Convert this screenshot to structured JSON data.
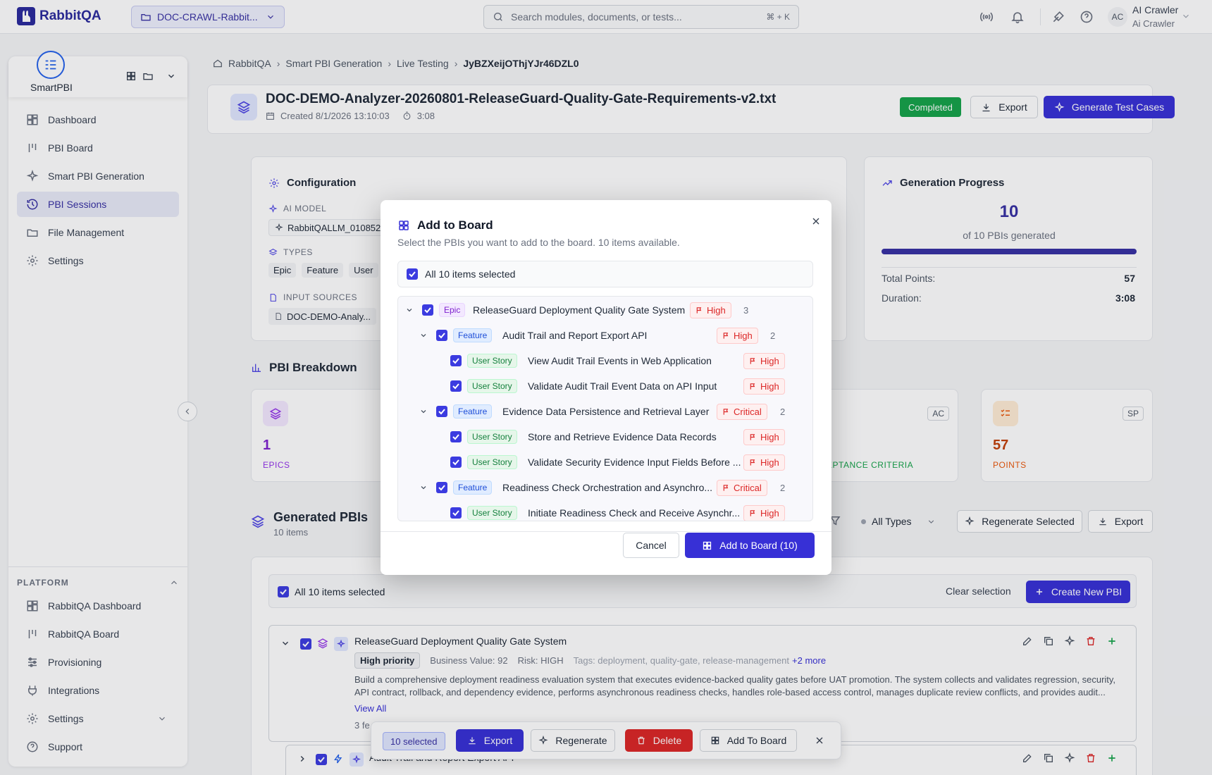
{
  "app": {
    "name": "RabbitQA"
  },
  "topbar": {
    "project": "DOC-CRAWL-Rabbit...",
    "search_placeholder": "Search modules, documents, or tests...",
    "shortcut": "⌘ + K",
    "avatar_initials": "AC",
    "user_name": "AI Crawler",
    "user_role": "Ai Crawler"
  },
  "sidebar": {
    "module_name": "SmartPBI",
    "items": [
      {
        "label": "Dashboard",
        "icon": "dashboard-icon"
      },
      {
        "label": "PBI Board",
        "icon": "board-icon"
      },
      {
        "label": "Smart PBI Generation",
        "icon": "sparkle-icon"
      },
      {
        "label": "PBI Sessions",
        "icon": "history-icon"
      },
      {
        "label": "File Management",
        "icon": "folder-icon"
      },
      {
        "label": "Settings",
        "icon": "gear-icon"
      }
    ],
    "platform_label": "PLATFORM",
    "platform_items": [
      {
        "label": "RabbitQA Dashboard"
      },
      {
        "label": "RabbitQA Board"
      },
      {
        "label": "Provisioning"
      },
      {
        "label": "Integrations"
      },
      {
        "label": "Settings"
      },
      {
        "label": "Support"
      }
    ]
  },
  "breadcrumb": [
    "RabbitQA",
    "Smart PBI Generation",
    "Live Testing",
    "JyBZXeijOThjYJr46DZL0"
  ],
  "header": {
    "title": "DOC-DEMO-Analyzer-20260801-ReleaseGuard-Quality-Gate-Requirements-v2.txt",
    "created": "Created 8/1/2026  13:10:03",
    "duration": "3:08",
    "status": "Completed",
    "export_label": "Export",
    "generate_label": "Generate Test Cases"
  },
  "config": {
    "title": "Configuration",
    "ai_model_label": "AI MODEL",
    "ai_model_value": "RabbitQALLM_010852",
    "types_label": "TYPES",
    "types": [
      "Epic",
      "Feature",
      "User"
    ],
    "sources_label": "INPUT SOURCES",
    "source_value": "DOC-DEMO-Analy..."
  },
  "progress": {
    "title": "Generation Progress",
    "count": "10",
    "caption": "of 10 PBIs generated",
    "fill_fraction": 1.0,
    "total_points_label": "Total Points:",
    "total_points": "57",
    "duration_label": "Duration:",
    "duration": "3:08"
  },
  "breakdown": {
    "title": "PBI Breakdown",
    "epics_count": "1",
    "epics_label": "EPICS",
    "ac_badge": "AC",
    "ac_label": "EPTANCE CRITERIA",
    "sp_badge": "SP",
    "points_count": "57",
    "points_label": "POINTS"
  },
  "generated": {
    "title": "Generated PBIs",
    "subtitle": "10 items",
    "filter_label": "All Types",
    "regenerate_selected": "Regenerate Selected",
    "export_label": "Export",
    "select_all": "All 10 items selected",
    "clear_selection": "Clear selection",
    "create_new": "Create New PBI",
    "item_title": "ReleaseGuard Deployment Quality Gate System",
    "priority": "High priority",
    "business_value": "Business Value: 92",
    "risk": "Risk: HIGH",
    "tags": "Tags: deployment, quality-gate, release-management",
    "more": "+2 more",
    "description": "Build a comprehensive deployment readiness evaluation system that executes evidence-backed quality gates before UAT promotion. The system collects and validates regression, security, API contract, rollback, and dependency evidence, performs asynchronous readiness checks, handles role-based access control, manages duplicate review conflicts, and provides audit...",
    "view_all": "View All",
    "features_partial": "3 fe",
    "child_title": "Audit Trail and Report Export API"
  },
  "bulkbar": {
    "selected": "10 selected",
    "export": "Export",
    "regenerate": "Regenerate",
    "delete": "Delete",
    "add_to_board": "Add To Board"
  },
  "modal": {
    "title": "Add to Board",
    "subtitle": "Select the PBIs you want to add to the board. 10 items available.",
    "select_all": "All 10 items selected",
    "items": [
      {
        "level": 0,
        "type": "Epic",
        "title": "ReleaseGuard Deployment Quality Gate System",
        "priority": "High",
        "children": "3"
      },
      {
        "level": 1,
        "type": "Feature",
        "title": "Audit Trail and Report Export API",
        "priority": "High",
        "children": "2"
      },
      {
        "level": 2,
        "type": "User Story",
        "title": "View Audit Trail Events in Web Application",
        "priority": "High"
      },
      {
        "level": 2,
        "type": "User Story",
        "title": "Validate Audit Trail Event Data on API Input",
        "priority": "High"
      },
      {
        "level": 1,
        "type": "Feature",
        "title": "Evidence Data Persistence and Retrieval Layer",
        "priority": "Critical",
        "children": "2"
      },
      {
        "level": 2,
        "type": "User Story",
        "title": "Store and Retrieve Evidence Data Records",
        "priority": "High"
      },
      {
        "level": 2,
        "type": "User Story",
        "title": "Validate Security Evidence Input Fields Before ...",
        "priority": "High"
      },
      {
        "level": 1,
        "type": "Feature",
        "title": "Readiness Check Orchestration and Asynchro...",
        "priority": "Critical",
        "children": "2"
      },
      {
        "level": 2,
        "type": "User Story",
        "title": "Initiate Readiness Check and Receive Asynchr...",
        "priority": "High"
      }
    ],
    "cancel": "Cancel",
    "confirm": "Add to Board (10)"
  }
}
